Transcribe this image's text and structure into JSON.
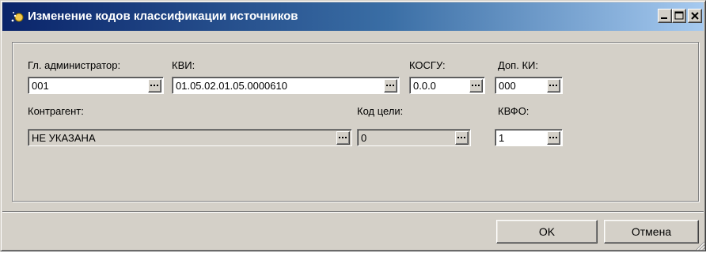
{
  "window": {
    "title": "Изменение кодов классификации источников",
    "title_icon": "app-icon",
    "controls": {
      "minimize": "minimize-icon",
      "maximize": "maximize-icon",
      "close": "close-icon"
    }
  },
  "form": {
    "admin": {
      "label": "Гл. администратор:",
      "value": "001"
    },
    "kvi": {
      "label": "КВИ:",
      "value": "01.05.02.01.05.0000610"
    },
    "kosgu": {
      "label": "КОСГУ:",
      "value": "0.0.0"
    },
    "dop_ki": {
      "label": "Доп. КИ:",
      "value": "000"
    },
    "contragent": {
      "label": "Контрагент:",
      "value": "НЕ УКАЗАНА"
    },
    "kod_celi": {
      "label": "Код цели:",
      "value": "0"
    },
    "kvfo": {
      "label": "КВФО:",
      "value": "1"
    }
  },
  "buttons": {
    "ok": "OK",
    "cancel": "Отмена"
  },
  "colors": {
    "title_start": "#0a246a",
    "title_end": "#a6caf0",
    "face": "#d4d0c8"
  }
}
